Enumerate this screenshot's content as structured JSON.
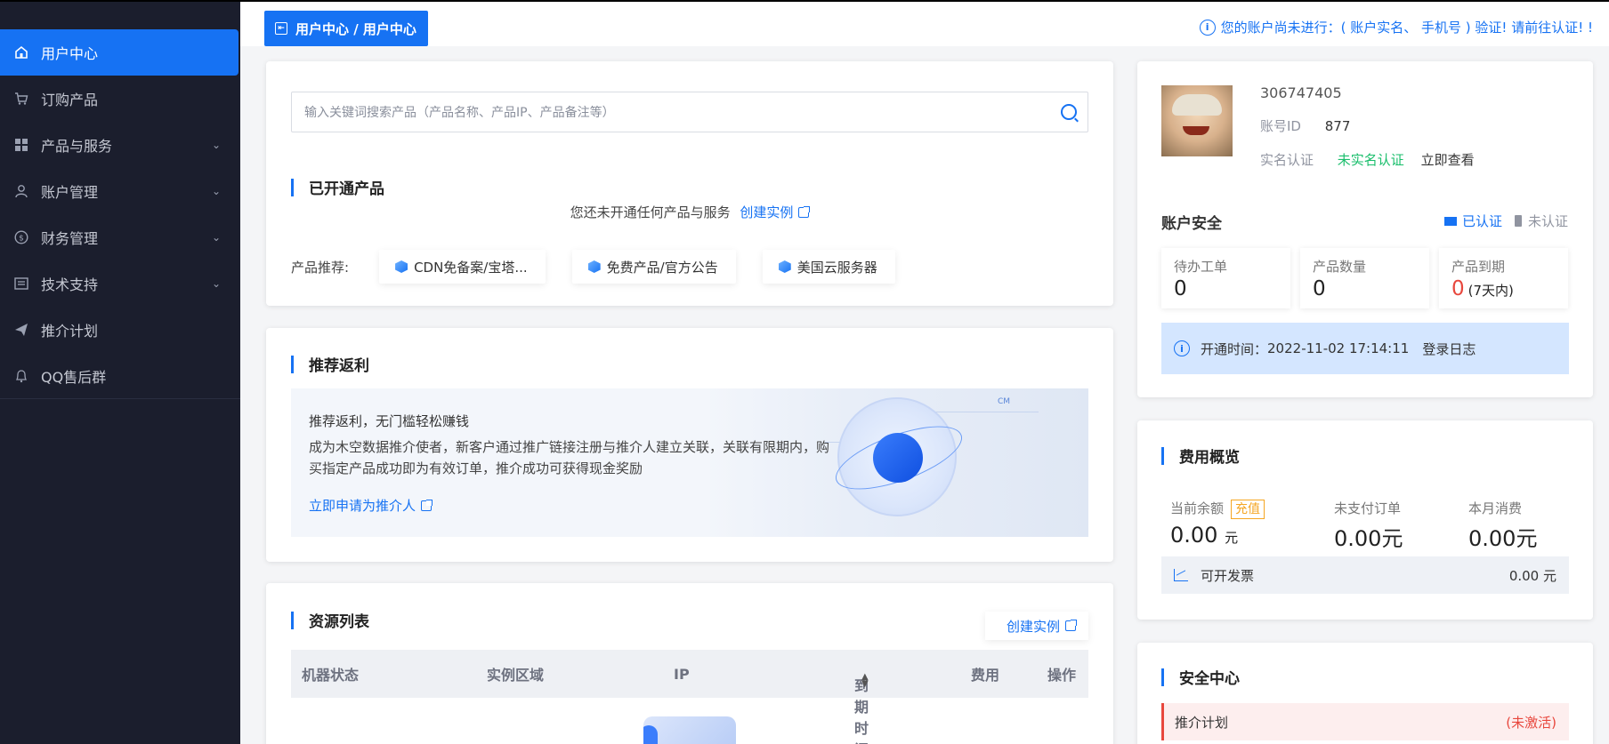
{
  "sidebar": {
    "items": [
      {
        "label": "用户中心",
        "icon": "home-icon",
        "active": true
      },
      {
        "label": "订购产品",
        "icon": "cart-icon"
      },
      {
        "label": "产品与服务",
        "icon": "grid-icon",
        "expandable": true
      },
      {
        "label": "账户管理",
        "icon": "user-icon",
        "expandable": true
      },
      {
        "label": "财务管理",
        "icon": "dollar-icon",
        "expandable": true
      },
      {
        "label": "技术支持",
        "icon": "list-icon",
        "expandable": true
      },
      {
        "label": "推介计划",
        "icon": "send-icon"
      },
      {
        "label": "QQ售后群",
        "icon": "bell-icon"
      }
    ]
  },
  "header": {
    "breadcrumb": "用户中心 / 用户中心",
    "notice": "您的账户尚未进行：( 账户实名、 手机号 ) 验证! 请前往认证! !"
  },
  "products": {
    "search_placeholder": "输入关键词搜索产品（产品名称、产品IP、产品备注等）",
    "title": "已开通产品",
    "empty_text": "您还未开通任何产品与服务",
    "create_link": "创建实例",
    "recommend_label": "产品推荐:",
    "recommend": [
      "CDN免备案/宝塔...",
      "免费产品/官方公告",
      "美国云服务器"
    ]
  },
  "referral": {
    "title": "推荐返利",
    "headline": "推荐返利，无门槛轻松赚钱",
    "desc": "成为木空数据推介使者，新客户通过推广链接注册与推介人建立关联，关联有限期内，购买指定产品成功即为有效订单，推介成功可获得现金奖励",
    "apply_link": "立即申请为推介人",
    "badge": "CM"
  },
  "resources": {
    "title": "资源列表",
    "create_button": "创建实例",
    "columns": [
      "机器状态",
      "实例区域",
      "IP",
      "到期时间",
      "费用",
      "操作"
    ]
  },
  "account": {
    "username": "306747405",
    "id_label": "账号ID",
    "id_value": "877",
    "realname_label": "实名认证",
    "realname_status": "未实名认证",
    "realname_action": "立即查看",
    "security_title": "账户安全",
    "verified": "已认证",
    "unverified": "未认证",
    "stats": [
      {
        "label": "待办工单",
        "value": "0"
      },
      {
        "label": "产品数量",
        "value": "0"
      },
      {
        "label": "产品到期",
        "value": "0",
        "suffix": "(7天内)"
      }
    ],
    "open_time_label": "开通时间：",
    "open_time": "2022-11-02 17:14:11",
    "login_log": "登录日志"
  },
  "fees": {
    "title": "费用概览",
    "balance_label": "当前余额",
    "recharge": "充值",
    "balance_value": "0.00",
    "balance_unit": "元",
    "unpaid_label": "未支付订单",
    "unpaid_value": "0.00元",
    "month_label": "本月消费",
    "month_value": "0.00元",
    "invoice_label": "可开发票",
    "invoice_value": "0.00 元"
  },
  "security": {
    "title": "安全中心",
    "row_label": "推介计划",
    "row_status": "(未激活)"
  },
  "colors": {
    "sidebar_bg": "#1b1e2d",
    "primary": "#1672f3",
    "success": "#19be6b",
    "danger": "#e8473d",
    "warning": "#f5a623"
  }
}
